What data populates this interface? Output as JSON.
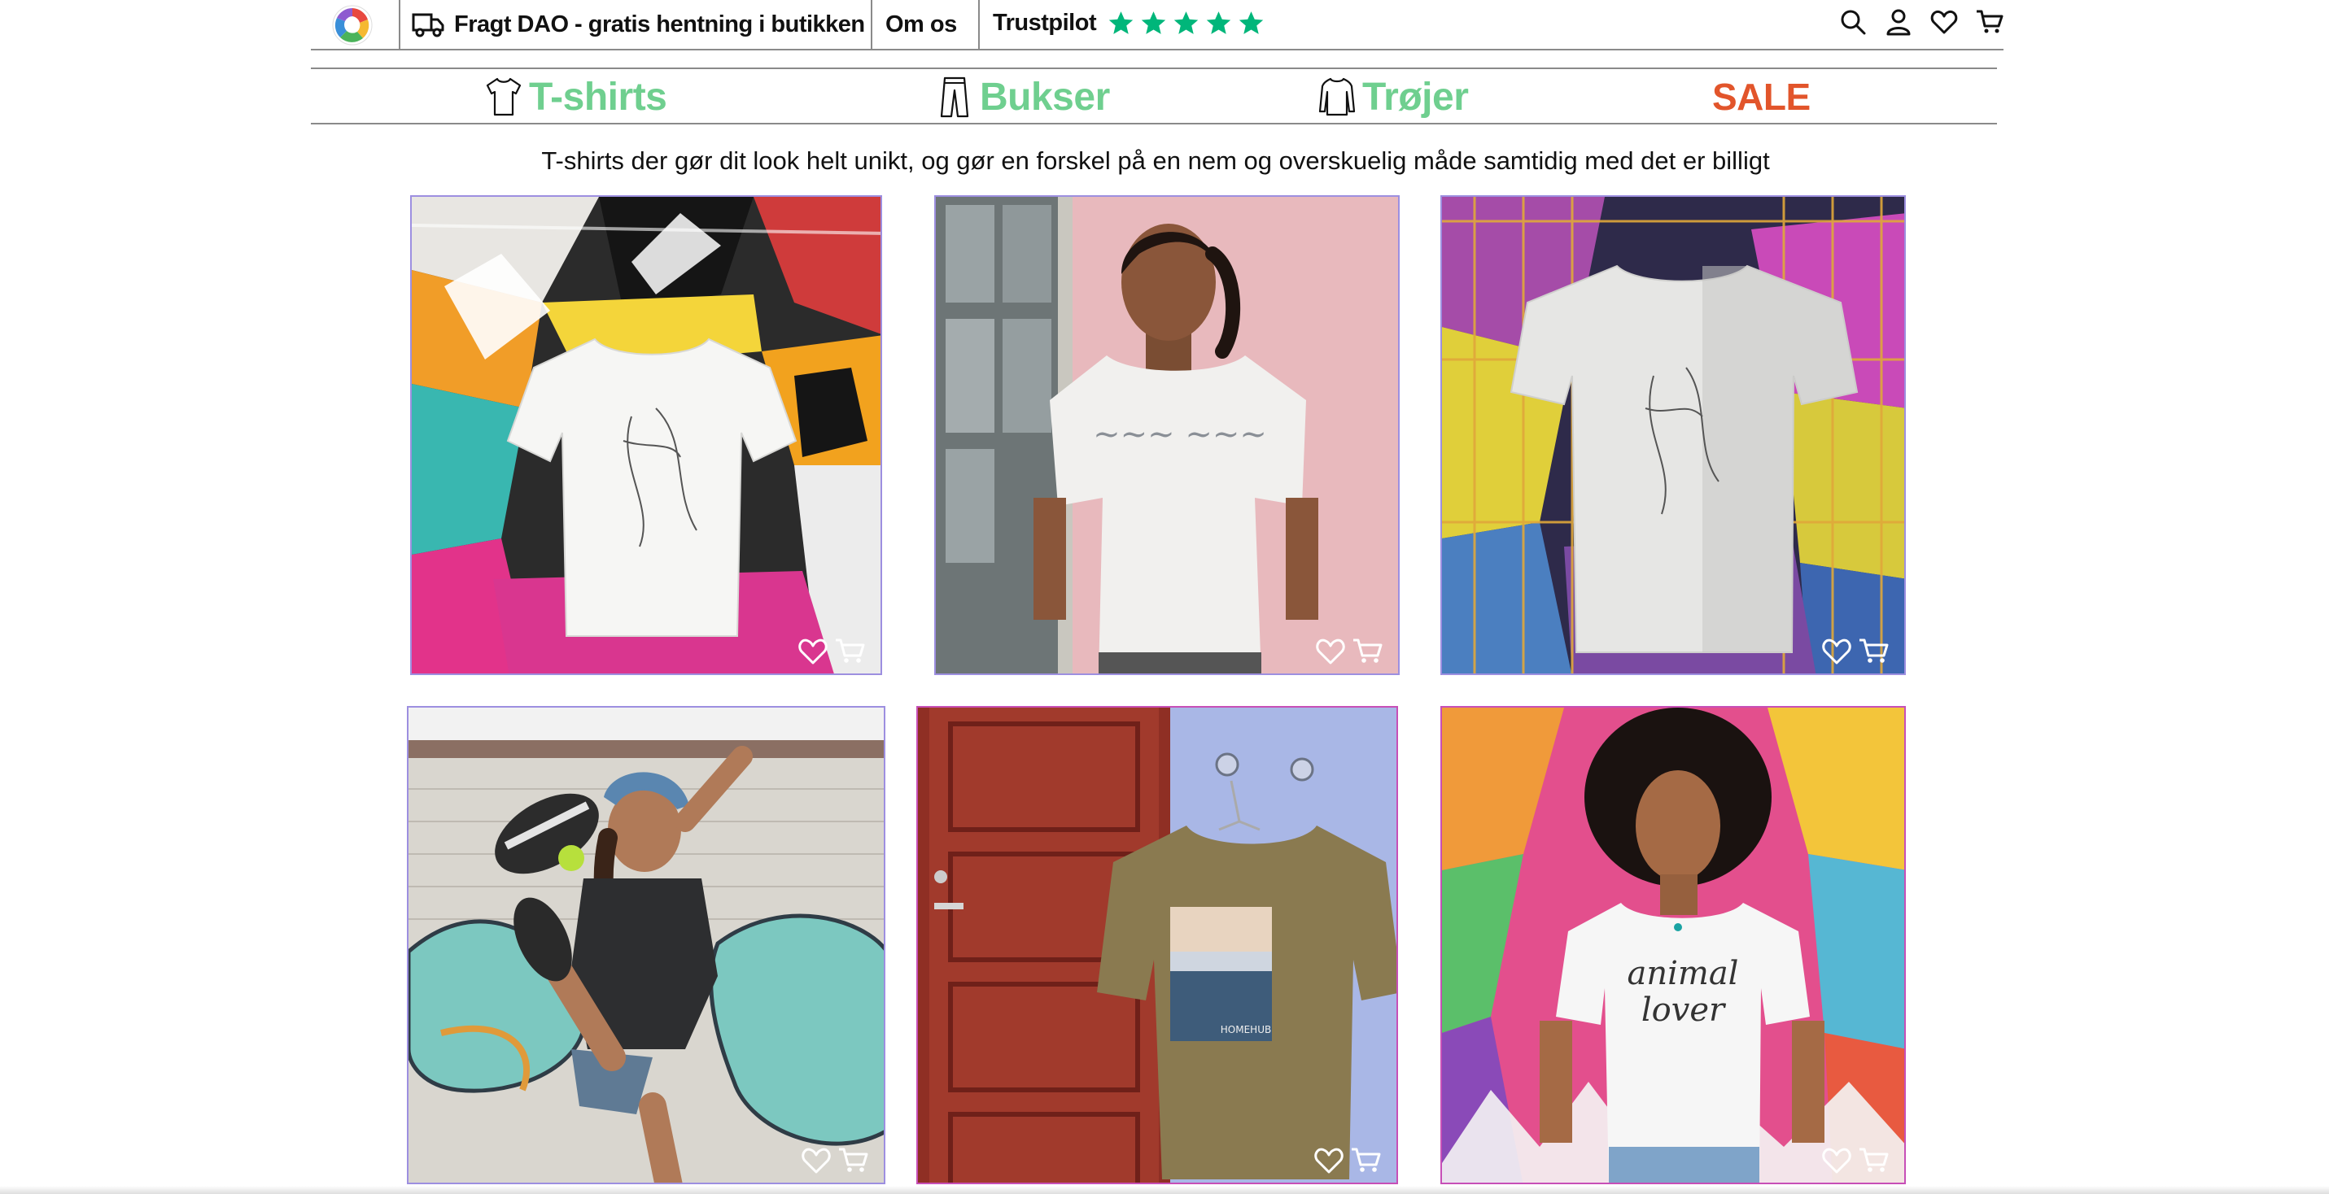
{
  "header": {
    "shipping_text": "Fragt DAO - gratis hentning i butikken",
    "about_label": "Om os",
    "trustpilot_label": "Trustpilot",
    "trustpilot_rating": 5,
    "star_color": "#00b67a",
    "icons": [
      "search-icon",
      "user-icon",
      "heart-icon",
      "cart-icon"
    ]
  },
  "categories": [
    {
      "label": "T-shirts",
      "icon": "tshirt-icon"
    },
    {
      "label": "Bukser",
      "icon": "pants-icon"
    },
    {
      "label": "Trøjer",
      "icon": "sweater-icon"
    },
    {
      "label": "SALE"
    }
  ],
  "colors": {
    "category_green": "#6fcf8f",
    "sale_red": "#e2552b"
  },
  "tagline": "T-shirts der gør dit look helt unikt, og gør en forskel på en nem og overskuelig måde samtidig med det er billigt",
  "products": [
    {
      "alt": "White t-shirt with line art face hanging in front of a graffiti wall"
    },
    {
      "alt": "Woman in white graphic t-shirt against pink wall"
    },
    {
      "alt": "Grey t-shirt with line art hanging on a yellow fence"
    },
    {
      "alt": "Skater in black t-shirt kicking in front of graffiti wall"
    },
    {
      "alt": "Olive t-shirt with print hanging next to red door"
    },
    {
      "alt": "Woman in white animal lover t-shirt in front of colorful wall"
    }
  ]
}
